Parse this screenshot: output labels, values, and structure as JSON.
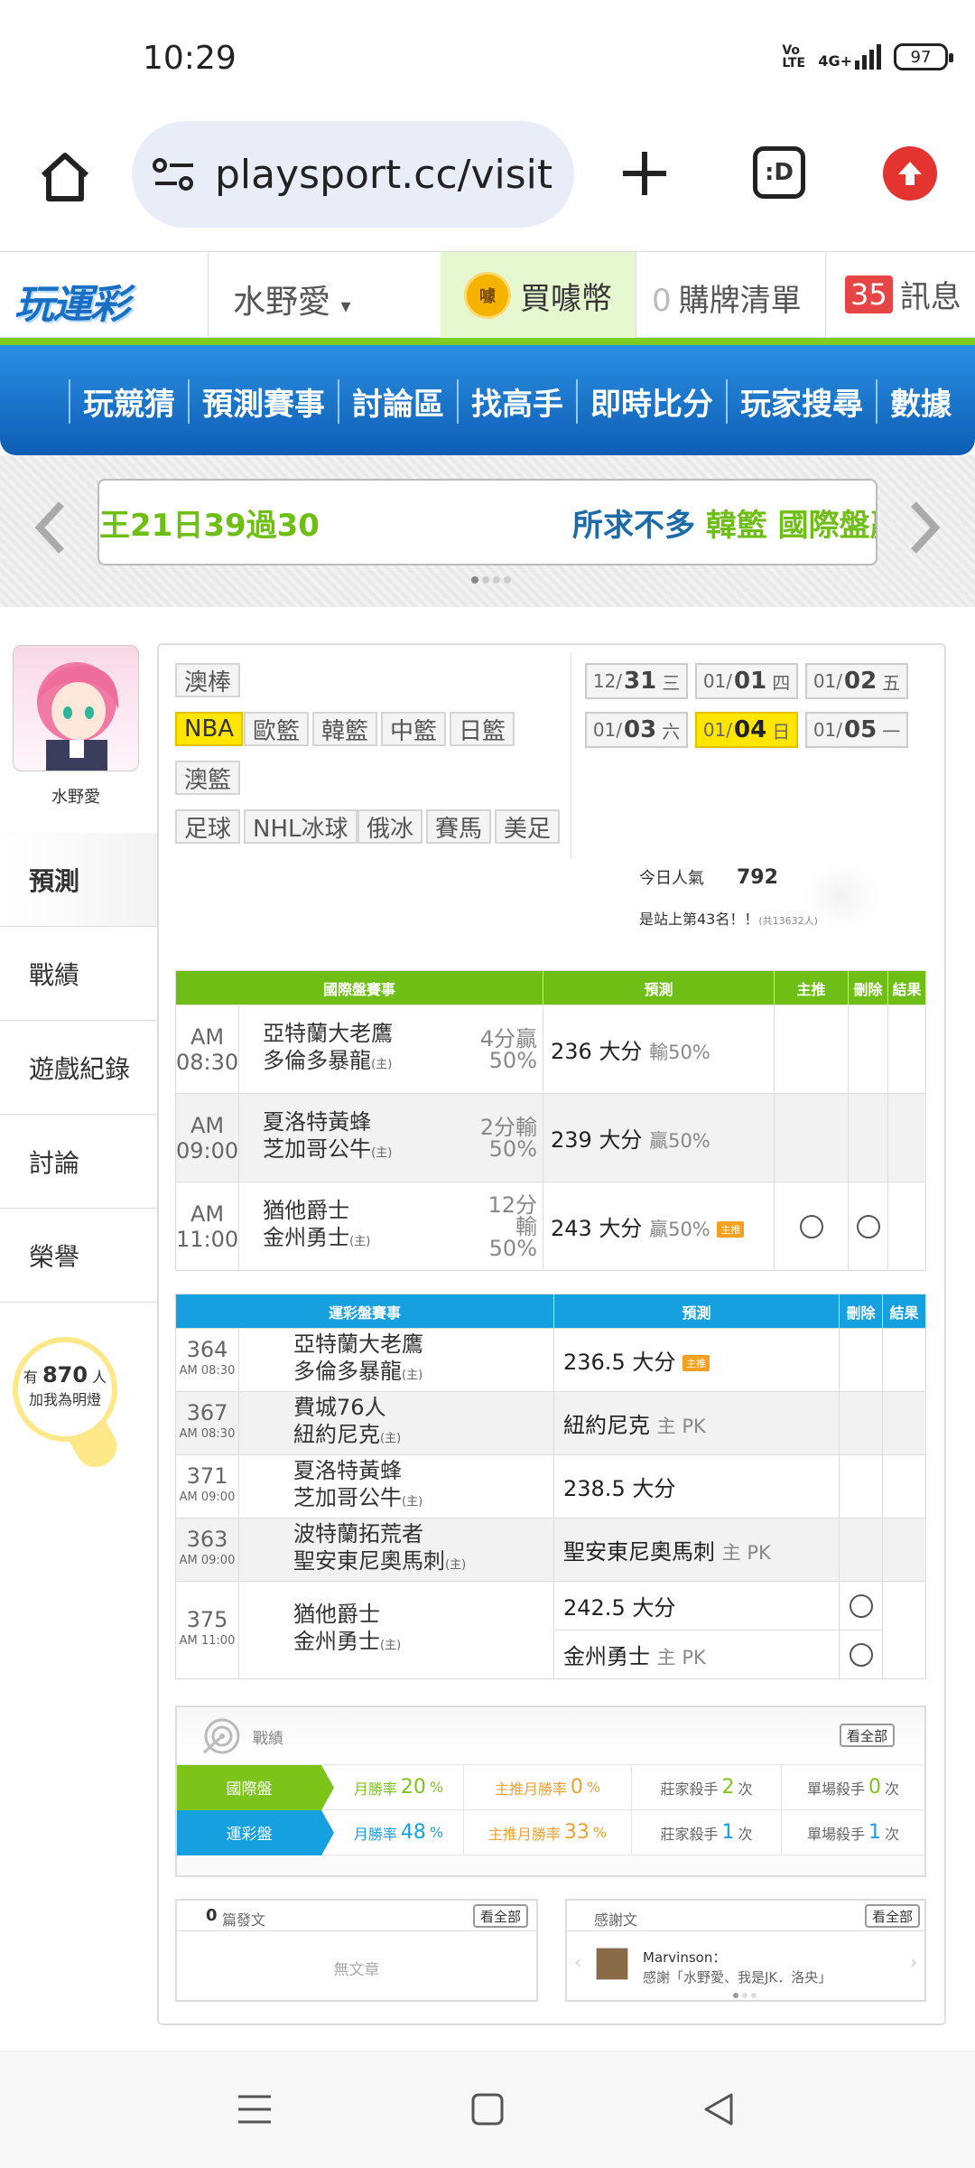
{
  "status": {
    "time": "10:29",
    "volte": "Vo LTE",
    "network": "4G+",
    "battery": "97"
  },
  "browser": {
    "url": "playsport.cc/visit",
    "tabs_label": ":D"
  },
  "header": {
    "logo": "玩運彩",
    "username": "水野愛",
    "buy_coin": "買噱幣",
    "coin_glyph": "噱",
    "cart_count": "0",
    "cart_label": "購牌清單",
    "msg_count": "35",
    "msg_label": "訊息"
  },
  "mainnav": [
    "玩競猜",
    "預測賽事",
    "討論區",
    "找高手",
    "即時比分",
    "玩家搜尋",
    "數據"
  ],
  "ticker": {
    "text1": "王21日39過30",
    "text2_blue": "所求不多",
    "text2_green": "韓籃 國際盤贏"
  },
  "profile": {
    "name": "水野愛"
  },
  "sidemenu": [
    "預測",
    "戰績",
    "遊戲紀錄",
    "討論",
    "榮譽"
  ],
  "bulb": {
    "pre": "有",
    "count": "870",
    "unit": "人",
    "line2": "加我為明燈"
  },
  "sports": {
    "row1": [
      "澳棒"
    ],
    "row2": [
      "NBA",
      "歐籃",
      "韓籃",
      "中籃",
      "日籃"
    ],
    "row3": [
      "澳籃"
    ],
    "row4": [
      "足球",
      "NHL冰球",
      "俄冰",
      "賽馬",
      "美足"
    ]
  },
  "dates": [
    {
      "md": "12/",
      "d": "31",
      "w": "三"
    },
    {
      "md": "01/",
      "d": "01",
      "w": "四"
    },
    {
      "md": "01/",
      "d": "02",
      "w": "五"
    },
    {
      "md": "01/",
      "d": "03",
      "w": "六"
    },
    {
      "md": "01/",
      "d": "04",
      "w": "日"
    },
    {
      "md": "01/",
      "d": "05",
      "w": "一"
    }
  ],
  "popularity": {
    "label": "今日人氣",
    "value": "792",
    "rank": "是站上第43名！！",
    "total": "(共13632人)"
  },
  "intl": {
    "headers": [
      "國際盤賽事",
      "預測",
      "主推",
      "刪除",
      "結果"
    ],
    "rows": [
      {
        "time": "AM 08:30",
        "away": "亞特蘭大老鷹",
        "home": "多倫多暴龍",
        "home_tag": "(主)",
        "line1": "4分贏",
        "line2": "50%",
        "pred": "236 大分",
        "pred_s": "輸50%",
        "badge": ""
      },
      {
        "time": "AM 09:00",
        "away": "夏洛特黃蜂",
        "home": "芝加哥公牛",
        "home_tag": "(主)",
        "line1": "2分輸",
        "line2": "50%",
        "pred": "239 大分",
        "pred_s": "贏50%",
        "badge": ""
      },
      {
        "time": "AM 11:00",
        "away": "猶他爵士",
        "home": "金州勇士",
        "home_tag": "(主)",
        "line1": "12分輸",
        "line2": "50%",
        "pred": "243 大分",
        "pred_s": "贏50%",
        "badge": "主推"
      }
    ]
  },
  "sports_lottery": {
    "headers": [
      "運彩盤賽事",
      "預測",
      "刪除",
      "結果"
    ],
    "rows": [
      {
        "num": "364",
        "time": "AM 08:30",
        "away": "亞特蘭大老鷹",
        "home": "多倫多暴龍",
        "home_tag": "(主)",
        "pred": "236.5 大分",
        "pred_s": "",
        "badge": "主推"
      },
      {
        "num": "367",
        "time": "AM 08:30",
        "away": "費城76人",
        "home": "紐約尼克",
        "home_tag": "(主)",
        "pred": "紐約尼克",
        "pred_s": "主 PK",
        "badge": ""
      },
      {
        "num": "371",
        "time": "AM 09:00",
        "away": "夏洛特黃蜂",
        "home": "芝加哥公牛",
        "home_tag": "(主)",
        "pred": "238.5 大分",
        "pred_s": "",
        "badge": ""
      },
      {
        "num": "363",
        "time": "AM 09:00",
        "away": "波特蘭拓荒者",
        "home": "聖安東尼奧馬刺",
        "home_tag": "(主)",
        "pred": "聖安東尼奧馬刺",
        "pred_s": "主 PK",
        "badge": ""
      },
      {
        "num": "375",
        "time": "AM 11:00",
        "away": "猶他爵士",
        "home": "金州勇士",
        "home_tag": "(主)",
        "pred": "242.5 大分",
        "pred_s": "",
        "pred2": "金州勇士",
        "pred2_s": "主 PK",
        "badge": ""
      }
    ]
  },
  "record": {
    "title": "戰績",
    "see_all": "看全部",
    "rows": [
      {
        "label": "國際盤",
        "c1": "月勝率",
        "v1": "20",
        "u1": "%",
        "c2": "主推月勝率",
        "v2": "0",
        "u2": "%",
        "c3": "莊家殺手",
        "v3": "2",
        "u3": "次",
        "c4": "單場殺手",
        "v4": "0",
        "u4": "次",
        "color": "#7cc41a"
      },
      {
        "label": "運彩盤",
        "c1": "月勝率",
        "v1": "48",
        "u1": "%",
        "c2": "主推月勝率",
        "v2": "33",
        "u2": "%",
        "c3": "莊家殺手",
        "v3": "1",
        "u3": "次",
        "c4": "單場殺手",
        "v4": "1",
        "u4": "次",
        "color": "#16a0e0"
      }
    ]
  },
  "posts": {
    "count": "0",
    "label": "篇發文",
    "see_all": "看全部",
    "empty": "無文章"
  },
  "thanks": {
    "label": "感謝文",
    "see_all": "看全部",
    "user": "Marvinson：",
    "text": "感謝「水野愛、我是JK．洛央」"
  }
}
